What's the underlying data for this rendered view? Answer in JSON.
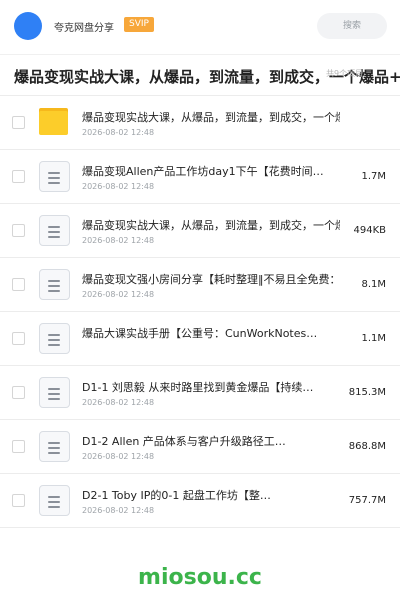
{
  "header": {
    "app_name": "夸克网盘分享",
    "badge": "SVIP",
    "search_label": "搜索"
  },
  "title_bar": {
    "title": "爆品变现实战大课，从爆品，到流量，到成交，一个爆品+Ⅰ",
    "overlay": "共9个项目"
  },
  "files": [
    {
      "type": "folder",
      "icon": "folder-icon",
      "name": "爆品变现实战大课，从爆品，到流量，到成交，一个爆品…",
      "date": "2026-08-02 12:48",
      "size": ""
    },
    {
      "type": "file",
      "icon": "document-icon",
      "name": "爆品变现Allen产品工作坊day1下午【花费时间…",
      "date": "2026-08-02 12:48",
      "size": "1.7M"
    },
    {
      "type": "file",
      "icon": "document-icon",
      "name": "爆品变现实战大课，从爆品，到流量，到成交，一个爆品…",
      "date": "2026-08-02 12:48",
      "size": "494KB"
    },
    {
      "type": "file",
      "icon": "document-icon",
      "name": "爆品变现文强小房间分享【耗时整理‖不易且全免费：c…",
      "date": "2026-08-02 12:48",
      "size": "8.1M"
    },
    {
      "type": "file",
      "icon": "document-icon",
      "name": "爆品大课实战手册【公重号：CunWorkNotes…",
      "date": "",
      "size": "1.1M"
    },
    {
      "type": "file",
      "icon": "document-icon",
      "name": "D1-1  刘思毅  从来时路里找到黄金爆品【持续…",
      "date": "2026-08-02 12:48",
      "size": "815.3M"
    },
    {
      "type": "file",
      "icon": "document-icon",
      "name": "D1-2  Allen  产品体系与客户升级路径工…",
      "date": "2026-08-02 12:48",
      "size": "868.8M"
    },
    {
      "type": "file",
      "icon": "document-icon",
      "name": "D2-1 Toby  IP的0-1 起盘工作坊【整…",
      "date": "2026-08-02 12:48",
      "size": "757.7M"
    }
  ],
  "watermark": "miosou.cc",
  "colors": {
    "accent": "#2f80f5",
    "badge": "#f7a73a",
    "folder": "#fccd2a",
    "watermark": "#3cb44b"
  }
}
